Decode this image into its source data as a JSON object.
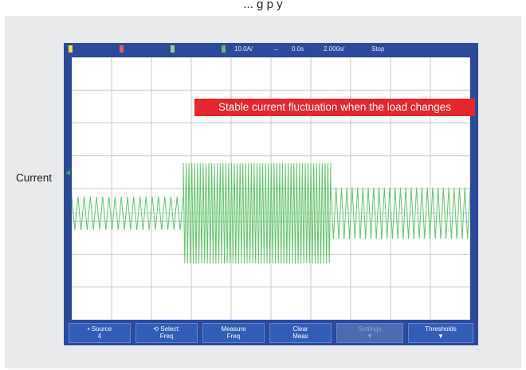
{
  "header_fragment": "... g  p   y",
  "annotation": "Stable current fluctuation when the load changes",
  "axis_label": "Current",
  "status_bar": {
    "scale": "10.0A/",
    "trigger_icon": "arrow-icon",
    "delay": "0.0s",
    "timebase": "2.000s/",
    "run_state": "Stop"
  },
  "softkeys": [
    {
      "line1": "Source",
      "line2": "4",
      "icon": "dot-icon",
      "enabled": true
    },
    {
      "line1": "Select:",
      "line2": "Freq",
      "icon": "knob-icon",
      "enabled": true
    },
    {
      "line1": "Measure",
      "line2": "Freq",
      "icon": "",
      "enabled": true
    },
    {
      "line1": "Clear",
      "line2": "Meas",
      "icon": "",
      "enabled": true
    },
    {
      "line1": "Settings",
      "line2": "",
      "icon": "down-arrow-icon",
      "enabled": false
    },
    {
      "line1": "Thresholds",
      "line2": "",
      "icon": "down-arrow-icon",
      "enabled": true
    }
  ],
  "waveform": {
    "color": "#63c46d",
    "segments": [
      {
        "from": 0.0,
        "to": 0.28,
        "amplitude": 0.3,
        "cycles": 18
      },
      {
        "from": 0.28,
        "to": 0.65,
        "amplitude": 0.9,
        "cycles": 52
      },
      {
        "from": 0.65,
        "to": 1.0,
        "amplitude": 0.46,
        "cycles": 26
      }
    ]
  },
  "colors": {
    "scope_frame": "#2b4a9a",
    "grid_line": "#c8c8c8",
    "annotation_bg": "#e8262b",
    "ch1": "#f4e24a",
    "ch2": "#e06060",
    "ch3": "#9ad27e",
    "ch4": "#5fc06a"
  }
}
